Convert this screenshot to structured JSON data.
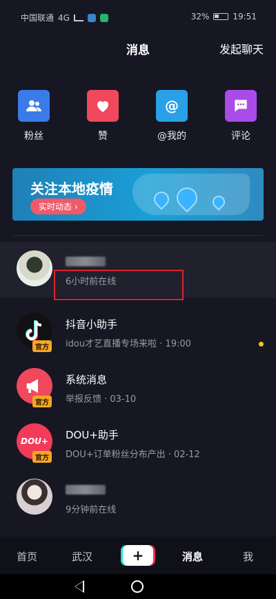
{
  "status": {
    "carrier": "中国联通",
    "network": "4G",
    "battery": "32%",
    "time": "19:51"
  },
  "header": {
    "title": "消息",
    "action": "发起聊天"
  },
  "quick_actions": [
    {
      "label": "粉丝",
      "icon": "fans-icon",
      "color": "#3b7be8"
    },
    {
      "label": "赞",
      "icon": "heart-icon",
      "color": "#f0485c"
    },
    {
      "label": "@我的",
      "icon": "at-icon",
      "color": "#2aa0e6"
    },
    {
      "label": "评论",
      "icon": "comment-icon",
      "color": "#a84be8"
    }
  ],
  "banner": {
    "title": "关注本地疫情",
    "button": "实时动态 ›"
  },
  "messages": [
    {
      "name": "",
      "subtitle": "6小时前在线",
      "official": false,
      "unread": false
    },
    {
      "name": "抖音小助手",
      "subtitle": "idou才艺直播专场来啦 · 19:00",
      "official": true,
      "badge": "官方",
      "unread": true
    },
    {
      "name": "系统消息",
      "subtitle": "举报反馈 · 03-10",
      "official": true,
      "badge": "官方",
      "unread": false
    },
    {
      "name": "DOU+助手",
      "subtitle": "DOU+订单粉丝分布产出 · 02-12",
      "official": true,
      "badge": "官方",
      "unread": false
    },
    {
      "name": "",
      "subtitle": "9分钟前在线",
      "official": false,
      "unread": false
    }
  ],
  "tabbar": {
    "home": "首页",
    "city": "武汉",
    "add": "+",
    "messages": "消息",
    "me": "我"
  }
}
